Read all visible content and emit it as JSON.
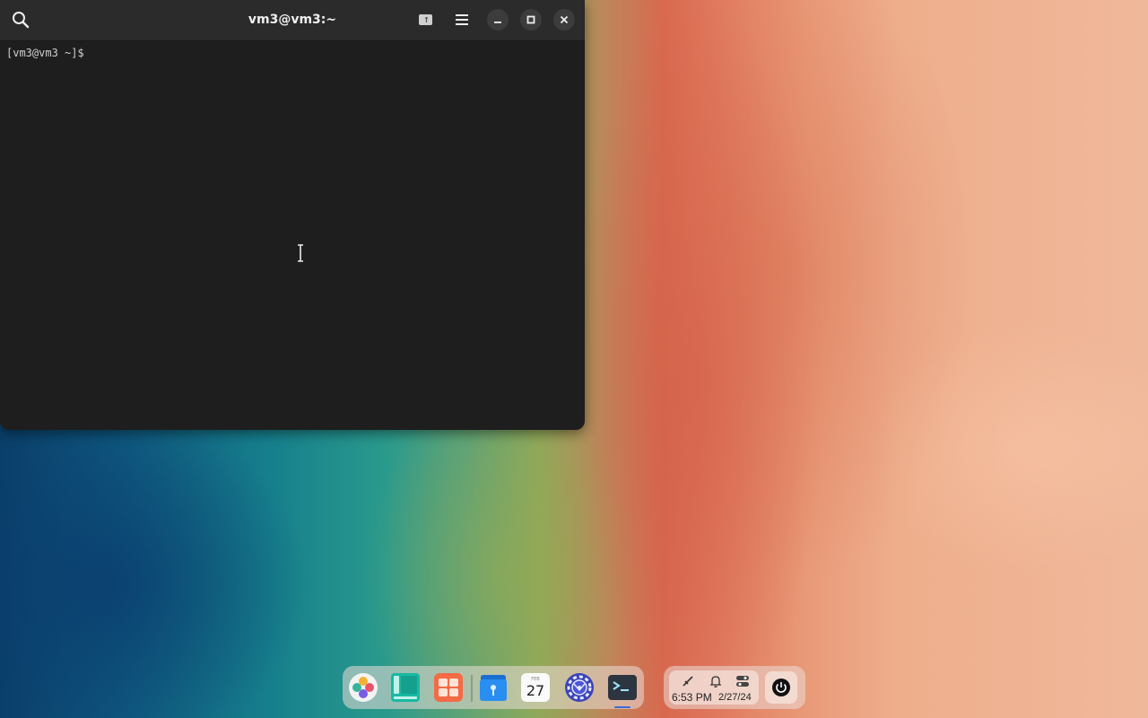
{
  "terminal": {
    "title": "vm3@vm3:~",
    "prompt": "[vm3@vm3 ~]$"
  },
  "icons": {
    "search": "search-icon",
    "new_tab": "new-tab-icon",
    "menu": "hamburger-menu-icon",
    "minimize": "minimize-icon",
    "maximize": "maximize-icon",
    "close": "close-icon"
  },
  "dock": {
    "apps": [
      {
        "name": "app-launcher",
        "icon": "launcher-icon"
      },
      {
        "name": "multitasking-view",
        "icon": "multitasking-icon"
      },
      {
        "name": "app-store",
        "icon": "app-store-icon"
      },
      {
        "name": "file-manager",
        "icon": "file-manager-icon"
      },
      {
        "name": "calendar",
        "icon": "calendar-icon",
        "month": "FEB",
        "day": "27"
      },
      {
        "name": "settings",
        "icon": "gear-icon"
      },
      {
        "name": "terminal",
        "icon": "terminal-icon"
      }
    ]
  },
  "tray": {
    "time": "6:53 PM",
    "date": "2/27/24"
  },
  "colors": {
    "terminal_bg": "#1e1e1e",
    "titlebar_bg": "#2b2b2b",
    "active_indicator": "#3a6bd6"
  }
}
